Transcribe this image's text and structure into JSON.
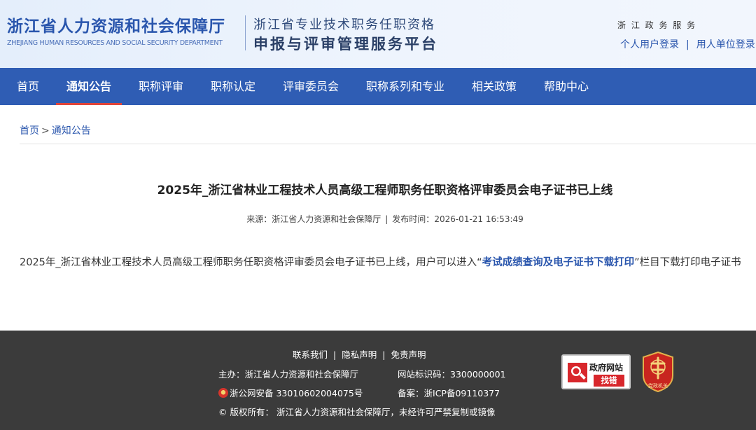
{
  "header": {
    "dept_cn": "浙江省人力资源和社会保障厅",
    "dept_en": "ZHEJIANG HUMAN RESOURCES AND SOCIAL SECURITY DEPARTMENT",
    "platform_line1": "浙江省专业技术职务任职资格",
    "platform_line2": "申报与评审管理服务平台",
    "gov_service": "浙 江 政 务 服 务",
    "personal_login": "个人用户登录",
    "login_sep": "|",
    "unit_login": "用人单位登录"
  },
  "nav": {
    "items": [
      "首页",
      "通知公告",
      "职称评审",
      "职称认定",
      "评审委员会",
      "职称系列和专业",
      "相关政策",
      "帮助中心"
    ],
    "active": "通知公告",
    "active_color": "#e0453b",
    "bg_color": "#2f5db4"
  },
  "breadcrumb": {
    "home": "首页",
    "sep": ">",
    "current": "通知公告"
  },
  "article": {
    "title": "2025年_浙江省林业工程技术人员高级工程师职务任职资格评审委员会电子证书已上线",
    "source_label": "来源：",
    "source": "浙江省人力资源和社会保障厅",
    "meta_sep": "|",
    "publish_label": "发布时间：",
    "publish_time": "2026-01-21 16:53:49",
    "body_before": "2025年_浙江省林业工程技术人员高级工程师职务任职资格评审委员会电子证书已上线，用户可以进入“",
    "body_link": "考试成绩查询及电子证书下载打印",
    "body_after": "”栏目下载打印电子证书"
  },
  "footer": {
    "links": [
      "联系我们",
      "隐私声明",
      "免责声明"
    ],
    "link_sep": "|",
    "sponsor_label": "主办：",
    "sponsor": "浙江省人力资源和社会保障厅",
    "site_id_label": "网站标识码：",
    "site_id": "3300000001",
    "police_record": "浙公网安备 33010602004075号",
    "icp_label": "备案：",
    "icp": "浙ICP备09110377",
    "copyright": "© 版权所有：  浙江省人力资源和社会保障厅，未经许可严禁复制或镜像",
    "badge_find_text": "政府网站",
    "badge_find_button": "找错",
    "badge_party_text": "党政机关"
  },
  "icons": {
    "police": "police-badge-icon",
    "find_error": "magnifier-icon",
    "party": "party-government-shield-icon"
  }
}
